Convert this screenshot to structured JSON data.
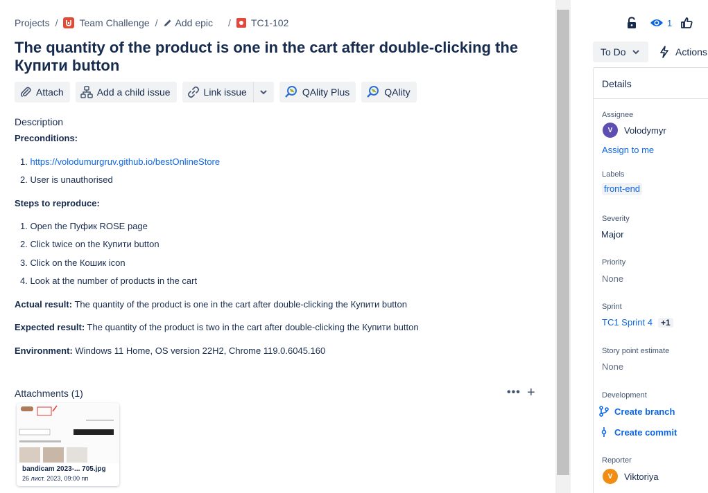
{
  "breadcrumb": {
    "projects": "Projects",
    "project": "Team Challenge",
    "epic": "Add epic",
    "issue_key": "TC1-102"
  },
  "issue": {
    "title": "The quantity of the product is one in the cart after double-clicking the Купити button"
  },
  "toolbar": {
    "attach": "Attach",
    "add_child": "Add a child issue",
    "link_issue": "Link issue",
    "qality_plus": "QAlity Plus",
    "qality": "QAlity"
  },
  "description": {
    "label": "Description",
    "preconditions_heading": "Preconditions:",
    "preconditions": [
      "1. https://volodumurgruv.github.io/bestOnlineStore",
      "2. User is unauthorised"
    ],
    "precondition_link": "https://volodumurgruv.github.io/bestOnlineStore",
    "steps_heading": "Steps to reproduce:",
    "steps": [
      "1. Open the Пуфик ROSE page",
      "2. Click twice on the Купити button",
      "3. Click on the Кошик icon",
      "4. Look at the number of products in the cart"
    ],
    "actual_label": "Actual result:",
    "actual_text": " The quantity of the product is one in the cart after double-clicking the Купити button",
    "expected_label": "Expected result:",
    "expected_text": " The quantity of the product is two in the cart after double-clicking the Купити button",
    "environment_label": "Environment:",
    "environment_text": " Windows 11 Home, OS version 22H2, Chrome 119.0.6045.160"
  },
  "attachments": {
    "label": "Attachments (1)",
    "more": "•••",
    "add": "+",
    "files": [
      {
        "name": "bandicam 2023-... 705.jpg",
        "date": "26 лист. 2023, 09:00 пп"
      }
    ]
  },
  "header_actions": {
    "watch_count": "1"
  },
  "status": {
    "label": "To Do",
    "actions": "Actions"
  },
  "details": {
    "heading": "Details",
    "assignee_label": "Assignee",
    "assignee_initial": "V",
    "assignee": "Volodymyr",
    "assign_to_me": "Assign to me",
    "labels_label": "Labels",
    "label_value": "front-end",
    "severity_label": "Severity",
    "severity": "Major",
    "priority_label": "Priority",
    "priority": "None",
    "sprint_label": "Sprint",
    "sprint": "TC1 Sprint 4",
    "sprint_more": "+1",
    "story_points_label": "Story point estimate",
    "story_points": "None",
    "development_label": "Development",
    "create_branch": "Create branch",
    "create_commit": "Create commit",
    "reporter_label": "Reporter",
    "reporter_initial": "V",
    "reporter": "Viktoriya"
  },
  "colors": {
    "link": "#0c66e4",
    "assignee_avatar": "#5e4db2",
    "reporter_avatar": "#f18d13",
    "issue_type_bug": "#e2483d",
    "project_icon": "#e34935"
  }
}
